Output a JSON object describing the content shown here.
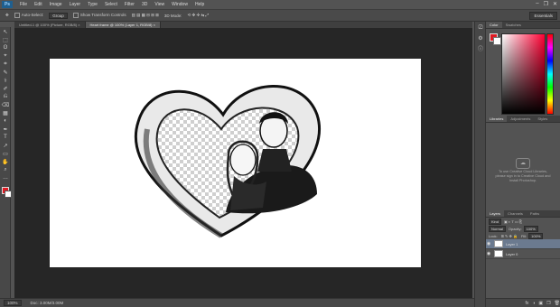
{
  "app": {
    "logo": "Ps"
  },
  "menu": [
    "File",
    "Edit",
    "Image",
    "Layer",
    "Type",
    "Select",
    "Filter",
    "3D",
    "View",
    "Window",
    "Help"
  ],
  "window_controls": [
    "–",
    "❐",
    "✕"
  ],
  "options_bar": {
    "auto_select_label": "Auto-Select:",
    "auto_select_value": "Group",
    "show_transform_label": "Show Transform Controls",
    "threed_mode_label": "3D Mode:",
    "workspace": "Essentials"
  },
  "tabs": [
    {
      "label": "Untitled-1 @ 100% (Picture, RGB/8) ×",
      "active": false
    },
    {
      "label": "Heart frame @ 100% (Layer 1, RGB/8) ×",
      "active": true
    }
  ],
  "tools": [
    "↖",
    "⬚",
    "ʘ",
    "⌖",
    "⌗",
    "✎",
    "⚕",
    "✐",
    "⎌",
    "⌫",
    "▦",
    "◐",
    "✒",
    "T",
    "↗",
    "▭",
    "✋",
    "⌕",
    "…"
  ],
  "status": {
    "zoom": "100%",
    "doc_info": "Doc: 3.00M/3.00M"
  },
  "color_panel": {
    "tabs": [
      "Color",
      "Swatches"
    ],
    "foreground": "#e01b24",
    "background": "#ffffff"
  },
  "libraries_panel": {
    "tabs": [
      "Libraries",
      "Adjustments",
      "Styles"
    ],
    "message": "To use Creative Cloud Libraries, please sign in to Creative Cloud and Install Photoshop."
  },
  "layers_panel": {
    "tabs": [
      "Layers",
      "Channels",
      "Paths"
    ],
    "kind_label": "Kind",
    "blend_mode": "Normal",
    "opacity_label": "Opacity:",
    "opacity_value": "100%",
    "lock_label": "Lock:",
    "fill_label": "Fill:",
    "fill_value": "100%",
    "layers": [
      {
        "name": "Layer 1",
        "selected": true
      },
      {
        "name": "Layer 0",
        "selected": false
      }
    ],
    "bottom_icons": [
      "fx",
      "◑",
      "▣",
      "❒",
      "🗑"
    ]
  },
  "canvas": {
    "document_background": "#ffffff"
  }
}
